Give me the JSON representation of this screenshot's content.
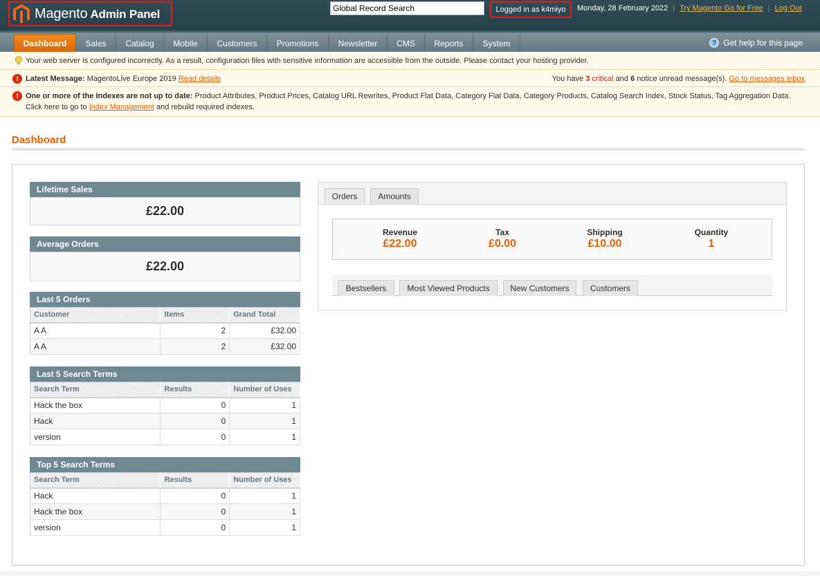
{
  "header": {
    "logo_text": "Magento",
    "logo_sub": "Admin Panel",
    "search_value": "Global Record Search",
    "logged_in": "Logged in as k4miyo",
    "date": "Monday, 28 February 2022",
    "try_link": "Try Magento Go for Free",
    "logout": "Log Out"
  },
  "nav": {
    "items": [
      "Dashboard",
      "Sales",
      "Catalog",
      "Mobile",
      "Customers",
      "Promotions",
      "Newsletter",
      "CMS",
      "Reports",
      "System"
    ],
    "help": "Get help for this page"
  },
  "messages": {
    "config_warning": "Your web server is configured incorrectly. As a result, configuration files with sensitive information are accessible from the outside. Please contact your hosting provider.",
    "latest_label": "Latest Message:",
    "latest_text": "MagentoLive Europe 2019",
    "latest_link": "Read details",
    "unread_pre": "You have",
    "critical_count": "3",
    "critical_word": "critical",
    "and_word": "and",
    "notice_count": "6",
    "unread_post": "notice unread message(s).",
    "inbox_link": "Go to messages inbox",
    "index_label": "One or more of the Indexes are not up to date:",
    "index_list": "Product Attributes, Product Prices, Catalog URL Rewrites, Product Flat Data, Category Flat Data, Category Products, Catalog Search Index, Stock Status, Tag Aggregation Data.",
    "index_click": "Click here to go to",
    "index_link": "Index Management",
    "index_post": "and rebuild required indexes."
  },
  "page": {
    "title": "Dashboard"
  },
  "lifetime_sales": {
    "label": "Lifetime Sales",
    "value": "£22.00"
  },
  "average_orders": {
    "label": "Average Orders",
    "value": "£22.00"
  },
  "last_orders": {
    "title": "Last 5 Orders",
    "columns": [
      "Customer",
      "Items",
      "Grand Total"
    ],
    "rows": [
      [
        "A A",
        "2",
        "£32.00"
      ],
      [
        "A A",
        "2",
        "£32.00"
      ]
    ]
  },
  "last_search": {
    "title": "Last 5 Search Terms",
    "columns": [
      "Search Term",
      "Results",
      "Number of Uses"
    ],
    "rows": [
      [
        "Hack the box",
        "0",
        "1"
      ],
      [
        "Hack",
        "0",
        "1"
      ],
      [
        "version",
        "0",
        "1"
      ]
    ]
  },
  "top_search": {
    "title": "Top 5 Search Terms",
    "columns": [
      "Search Term",
      "Results",
      "Number of Uses"
    ],
    "rows": [
      [
        "Hack",
        "0",
        "1"
      ],
      [
        "Hack the box",
        "0",
        "1"
      ],
      [
        "version",
        "0",
        "1"
      ]
    ]
  },
  "chart_tabs": [
    "Orders",
    "Amounts"
  ],
  "totals": [
    {
      "label": "Revenue",
      "value": "£22.00"
    },
    {
      "label": "Tax",
      "value": "£0.00"
    },
    {
      "label": "Shipping",
      "value": "£10.00"
    },
    {
      "label": "Quantity",
      "value": "1"
    }
  ],
  "grid_tabs": [
    "Bestsellers",
    "Most Viewed Products",
    "New Customers",
    "Customers"
  ],
  "colors": {
    "accent": "#eb5e00",
    "header": "#2f4b54",
    "highlight_box": "#e41b1b"
  }
}
